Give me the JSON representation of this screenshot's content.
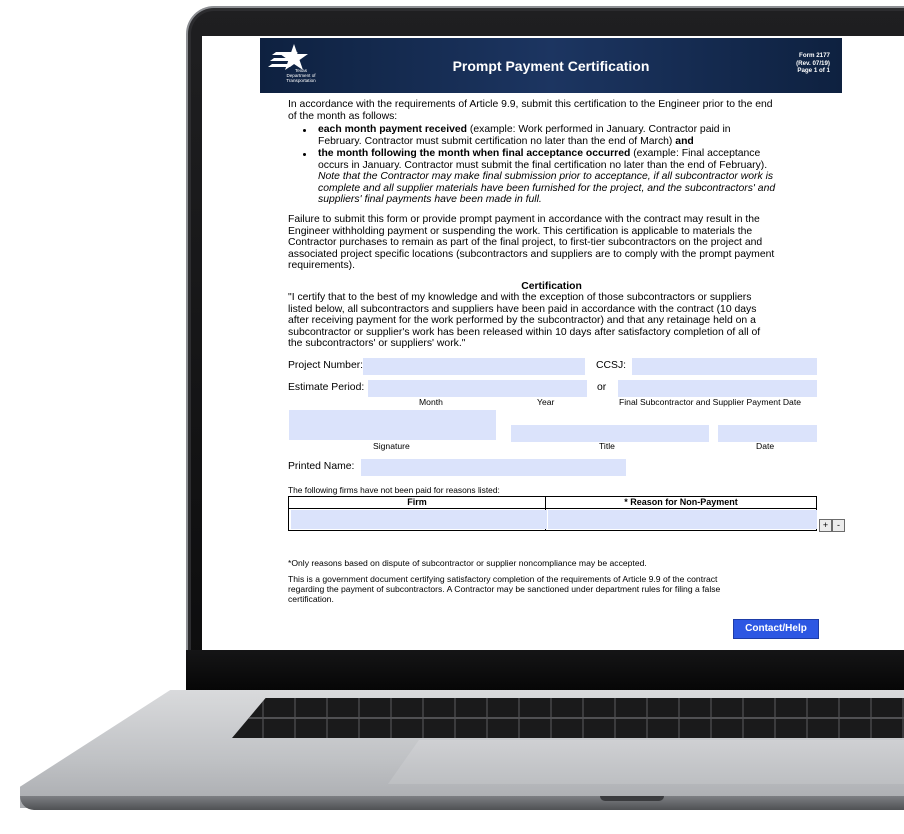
{
  "header": {
    "agency": "Texas Department of Transportation",
    "title": "Prompt Payment Certification",
    "form_number": "Form 2177",
    "revision": "(Rev. 07/19)",
    "page": "Page 1 of 1"
  },
  "intro": {
    "line1": "In accordance with the requirements of Article 9.9, submit this certification to the Engineer prior to the end",
    "line2": "of the month as follows:",
    "bullet1_bold": "each month payment received",
    "bullet1_rest": " (example: Work performed in January. Contractor paid in",
    "bullet1_line2": "February. Contractor must submit certification no later than the end of March) ",
    "bullet1_and": "and",
    "bullet2_bold": "the month following the month when final acceptance occurred",
    "bullet2_rest": " (example: Final acceptance",
    "bullet2_line2": "occurs in January. Contractor must submit the final certification no later than the end of February).",
    "note_line1": "Note that the Contractor may make final submission prior to acceptance, if all subcontractor work is",
    "note_line2": "complete and all supplier materials have been furnished for the project, and the subcontractors' and",
    "note_line3": "suppliers' final payments have been made in full."
  },
  "failure": {
    "line1": "Failure to submit this form or provide prompt payment in accordance with the contract may result in the",
    "line2": "Engineer withholding payment or suspending the work. This certification is applicable to materials the",
    "line3": "Contractor purchases to remain as part of the final project, to first-tier subcontractors on the project and",
    "line4": "associated project specific locations (subcontractors and suppliers are to comply with the prompt payment",
    "line5": "requirements)."
  },
  "certification": {
    "heading": "Certification",
    "line1": "\"I certify that to the best of my knowledge and with the exception of those subcontractors or suppliers",
    "line2": "listed below, all subcontractors and suppliers have been paid in accordance with the contract (10 days",
    "line3": "after receiving payment for the work performed by the subcontractor) and that any retainage held on a",
    "line4": "subcontractor or supplier's work has been released within 10 days after satisfactory completion of all of",
    "line5": "the subcontractors' or suppliers' work.\""
  },
  "fields": {
    "project_number_label": "Project Number:",
    "ccsj_label": "CCSJ:",
    "estimate_period_label": "Estimate Period:",
    "or_label": "or",
    "month_label": "Month",
    "year_label": "Year",
    "final_payment_date_label": "Final Subcontractor and Supplier Payment Date",
    "signature_label": "Signature",
    "title_label": "Title",
    "date_label": "Date",
    "printed_name_label": "Printed Name:"
  },
  "table": {
    "caption": "The following firms have not been paid for reasons listed:",
    "col_firm": "Firm",
    "col_reason": "* Reason for Non-Payment",
    "add_label": "+",
    "remove_label": "-"
  },
  "footer": {
    "note": "*Only reasons based on dispute of subcontractor or supplier noncompliance may be accepted.",
    "line1": "This is a government document certifying satisfactory completion of the requirements of Article 9.9 of the contract",
    "line2": "regarding  the payment of subcontractors. A Contractor may be sanctioned under department rules for filing a false",
    "line3": "certification.",
    "contact_button": "Contact/Help"
  },
  "colors": {
    "banner": "#1c3561",
    "field_fill": "#dbe3fb",
    "button": "#2d57e3"
  }
}
